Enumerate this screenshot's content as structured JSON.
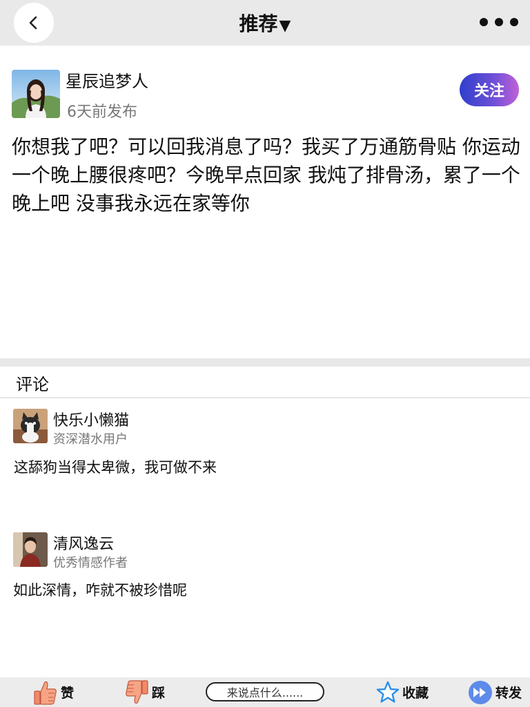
{
  "header": {
    "title": "推荐",
    "title_caret": "▼"
  },
  "post": {
    "author": "星辰追梦人",
    "time": "6天前发布",
    "follow_label": "关注",
    "body": "你想我了吧？可以回我消息了吗？我买了万通筋骨贴 你运动一个晚上腰很疼吧？今晚早点回家 我炖了排骨汤，累了一个晚上吧 没事我永远在家等你"
  },
  "comments": {
    "section_title": "评论",
    "items": [
      {
        "name": "快乐小懒猫",
        "role": "资深潜水用户",
        "text": "这舔狗当得太卑微，我可做不来"
      },
      {
        "name": "清风逸云",
        "role": "优秀情感作者",
        "text": "如此深情，咋就不被珍惜呢"
      }
    ]
  },
  "bottom_bar": {
    "like_label": "赞",
    "dislike_label": "踩",
    "input_placeholder": "来说点什么......",
    "favorite_label": "收藏",
    "share_label": "转发"
  },
  "colors": {
    "header_bg": "#e9e9e9",
    "follow_gradient_start": "#2f3fcb",
    "follow_gradient_end": "#c061d8",
    "like_icon": "#f08a6a",
    "favorite_icon": "#2a8ee8",
    "share_icon": "#5d8bea"
  },
  "icons": {
    "back": "chevron-left-icon",
    "more": "more-dots-icon",
    "like": "thumbs-up-icon",
    "dislike": "thumbs-down-icon",
    "favorite": "star-icon",
    "share": "fast-forward-icon"
  }
}
